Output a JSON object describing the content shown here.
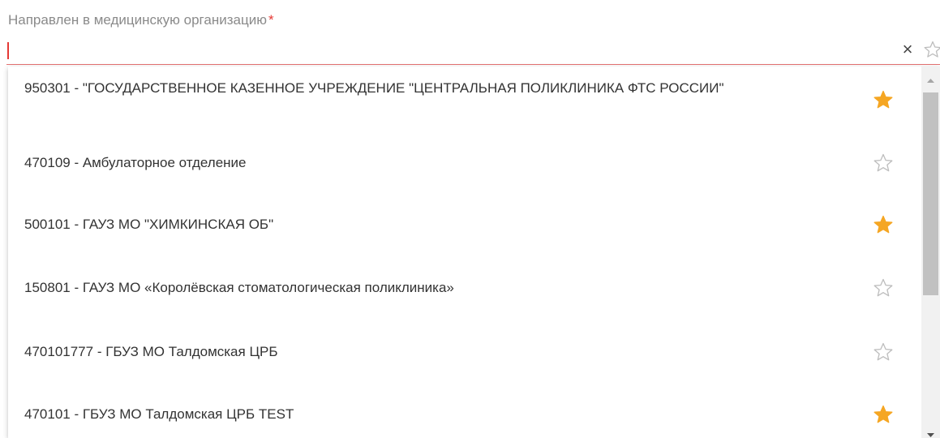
{
  "field": {
    "label": "Направлен в медицинскую организацию",
    "required_mark": "*",
    "value": "",
    "clear_icon": "×"
  },
  "colors": {
    "required": "#e53935",
    "star_active": "#f5a623",
    "star_inactive": "#bdbdbd",
    "underline": "#e57373"
  },
  "options": [
    {
      "text": "950301 - \"ГОСУДАРСТВЕННОЕ КАЗЕННОЕ УЧРЕЖДЕНИЕ \"ЦЕНТРАЛЬНАЯ ПОЛИКЛИНИКА ФТС РОССИИ\"",
      "favorite": true
    },
    {
      "text": "470109 - Амбулаторное отделение",
      "favorite": false
    },
    {
      "text": "500101 - ГАУЗ МО \"ХИМКИНСКАЯ ОБ\"",
      "favorite": true
    },
    {
      "text": "150801 - ГАУЗ МО «Королёвская стоматологическая поликлиника»",
      "favorite": false
    },
    {
      "text": "470101777 - ГБУЗ МО Талдомская ЦРБ",
      "favorite": false
    },
    {
      "text": "470101 - ГБУЗ МО Талдомская ЦРБ TEST",
      "favorite": true
    }
  ]
}
